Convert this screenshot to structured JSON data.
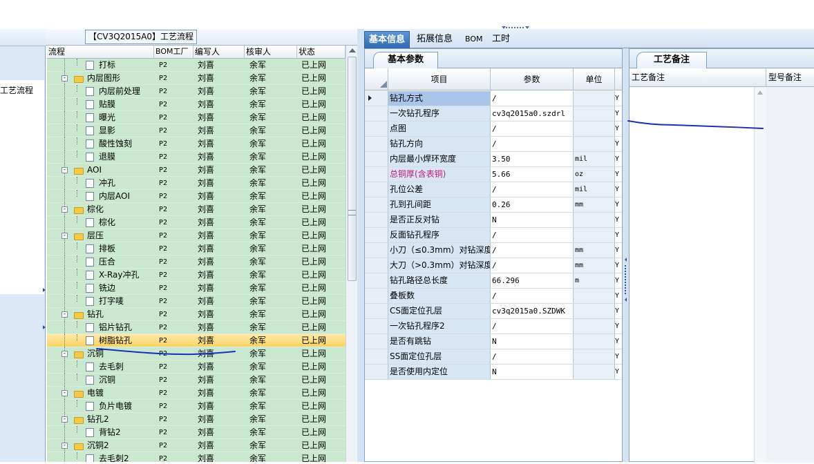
{
  "left_nav": {
    "item_label": "工艺流程"
  },
  "process": {
    "title": "【CV3Q2015A0】工艺流程",
    "columns": {
      "flow": "流程",
      "bom": "BOM工厂",
      "author": "编写人",
      "reviewer": "核审人",
      "status": "状态"
    },
    "rows": [
      {
        "name": "打标",
        "level": 1,
        "type": "doc",
        "bom": "P2",
        "author": "刘喜",
        "reviewer": "余军",
        "status": "已上网"
      },
      {
        "name": "内层图形",
        "level": 0,
        "type": "folder",
        "bom": "P2",
        "author": "刘喜",
        "reviewer": "余军",
        "status": "已上网"
      },
      {
        "name": "内层前处理",
        "level": 1,
        "type": "doc",
        "bom": "P2",
        "author": "刘喜",
        "reviewer": "余军",
        "status": "已上网"
      },
      {
        "name": "贴膜",
        "level": 1,
        "type": "doc",
        "bom": "P2",
        "author": "刘喜",
        "reviewer": "余军",
        "status": "已上网"
      },
      {
        "name": "曝光",
        "level": 1,
        "type": "doc",
        "bom": "P2",
        "author": "刘喜",
        "reviewer": "余军",
        "status": "已上网"
      },
      {
        "name": "显影",
        "level": 1,
        "type": "doc",
        "bom": "P2",
        "author": "刘喜",
        "reviewer": "余军",
        "status": "已上网"
      },
      {
        "name": "酸性蚀刻",
        "level": 1,
        "type": "doc",
        "bom": "P2",
        "author": "刘喜",
        "reviewer": "余军",
        "status": "已上网"
      },
      {
        "name": "退膜",
        "level": 1,
        "type": "doc",
        "bom": "P2",
        "author": "刘喜",
        "reviewer": "余军",
        "status": "已上网"
      },
      {
        "name": "AOI",
        "level": 0,
        "type": "folder",
        "bom": "P2",
        "author": "刘喜",
        "reviewer": "余军",
        "status": "已上网"
      },
      {
        "name": "冲孔",
        "level": 1,
        "type": "doc",
        "bom": "P2",
        "author": "刘喜",
        "reviewer": "余军",
        "status": "已上网"
      },
      {
        "name": "内层AOI",
        "level": 1,
        "type": "doc",
        "bom": "P2",
        "author": "刘喜",
        "reviewer": "余军",
        "status": "已上网"
      },
      {
        "name": "棕化",
        "level": 0,
        "type": "folder",
        "bom": "P2",
        "author": "刘喜",
        "reviewer": "余军",
        "status": "已上网"
      },
      {
        "name": "棕化",
        "level": 1,
        "type": "doc",
        "bom": "P2",
        "author": "刘喜",
        "reviewer": "余军",
        "status": "已上网"
      },
      {
        "name": "层压",
        "level": 0,
        "type": "folder",
        "bom": "P2",
        "author": "刘喜",
        "reviewer": "余军",
        "status": "已上网"
      },
      {
        "name": "排板",
        "level": 1,
        "type": "doc",
        "bom": "P2",
        "author": "刘喜",
        "reviewer": "余军",
        "status": "已上网"
      },
      {
        "name": "压合",
        "level": 1,
        "type": "doc",
        "bom": "P2",
        "author": "刘喜",
        "reviewer": "余军",
        "status": "已上网"
      },
      {
        "name": "X-Ray冲孔",
        "level": 1,
        "type": "doc",
        "bom": "P2",
        "author": "刘喜",
        "reviewer": "余军",
        "status": "已上网"
      },
      {
        "name": "铣边",
        "level": 1,
        "type": "doc",
        "bom": "P2",
        "author": "刘喜",
        "reviewer": "余军",
        "status": "已上网"
      },
      {
        "name": "打字唛",
        "level": 1,
        "type": "doc",
        "bom": "P2",
        "author": "刘喜",
        "reviewer": "余军",
        "status": "已上网"
      },
      {
        "name": "钻孔",
        "level": 0,
        "type": "folder",
        "bom": "P2",
        "author": "刘喜",
        "reviewer": "余军",
        "status": "已上网"
      },
      {
        "name": "铝片钻孔",
        "level": 1,
        "type": "doc",
        "bom": "P2",
        "author": "刘喜",
        "reviewer": "余军",
        "status": "已上网"
      },
      {
        "name": "树脂钻孔",
        "level": 1,
        "type": "doc",
        "bom": "P2",
        "author": "刘喜",
        "reviewer": "余军",
        "status": "已上网",
        "selected": true
      },
      {
        "name": "沉铜",
        "level": 0,
        "type": "folder",
        "bom": "P2",
        "author": "刘喜",
        "reviewer": "余军",
        "status": "已上网"
      },
      {
        "name": "去毛刺",
        "level": 1,
        "type": "doc",
        "bom": "P2",
        "author": "刘喜",
        "reviewer": "余军",
        "status": "已上网"
      },
      {
        "name": "沉铜",
        "level": 1,
        "type": "doc",
        "bom": "P2",
        "author": "刘喜",
        "reviewer": "余军",
        "status": "已上网"
      },
      {
        "name": "电镀",
        "level": 0,
        "type": "folder",
        "bom": "P2",
        "author": "刘喜",
        "reviewer": "余军",
        "status": "已上网"
      },
      {
        "name": "负片电镀",
        "level": 1,
        "type": "doc",
        "bom": "P2",
        "author": "刘喜",
        "reviewer": "余军",
        "status": "已上网"
      },
      {
        "name": "钻孔2",
        "level": 0,
        "type": "folder",
        "bom": "P2",
        "author": "刘喜",
        "reviewer": "余军",
        "status": "已上网"
      },
      {
        "name": "背钻2",
        "level": 1,
        "type": "doc",
        "bom": "P2",
        "author": "刘喜",
        "reviewer": "余军",
        "status": "已上网"
      },
      {
        "name": "沉铜2",
        "level": 0,
        "type": "folder",
        "bom": "P2",
        "author": "刘喜",
        "reviewer": "余军",
        "status": "已上网"
      },
      {
        "name": "去毛刺2",
        "level": 1,
        "type": "doc",
        "bom": "P2",
        "author": "刘喜",
        "reviewer": "余军",
        "status": "已上网"
      }
    ]
  },
  "tabs": {
    "items": [
      {
        "label": "基本信息",
        "active": true
      },
      {
        "label": "拓展信息",
        "active": false
      },
      {
        "label": "BOM",
        "active": false
      },
      {
        "label": "工时",
        "active": false
      }
    ]
  },
  "basic": {
    "tab_label": "基本参数",
    "columns": {
      "item": "项目",
      "param": "参数",
      "unit": "单位"
    },
    "rows": [
      {
        "item": "钻孔方式",
        "value": "/",
        "unit": "",
        "flag": "Y",
        "current": true
      },
      {
        "item": "一次钻孔程序",
        "value": "cv3q2015a0.szdrl",
        "unit": "",
        "flag": "Y"
      },
      {
        "item": "点图",
        "value": "/",
        "unit": "",
        "flag": "Y"
      },
      {
        "item": "钻孔方向",
        "value": "/",
        "unit": "",
        "flag": "Y"
      },
      {
        "item": "内层最小焊环宽度",
        "value": "3.50",
        "unit": "mil",
        "flag": "Y"
      },
      {
        "item": "总铜厚(含表铜)",
        "value": "5.66",
        "unit": "oz",
        "flag": "Y",
        "highlight": true
      },
      {
        "item": "孔位公差",
        "value": "/",
        "unit": "mil",
        "flag": "Y"
      },
      {
        "item": "孔到孔间距",
        "value": "0.26",
        "unit": "mm",
        "flag": "Y"
      },
      {
        "item": "是否正反对钻",
        "value": "N",
        "unit": "",
        "flag": "Y"
      },
      {
        "item": "反面钻孔程序",
        "value": "/",
        "unit": "",
        "flag": "Y"
      },
      {
        "item": "小刀（≤0.3mm）对钻深度",
        "value": "/",
        "unit": "mm",
        "flag": "Y"
      },
      {
        "item": "大刀（>0.3mm）对钻深度",
        "value": "/",
        "unit": "mm",
        "flag": "Y"
      },
      {
        "item": "钻孔路径总长度",
        "value": "66.296",
        "unit": "m",
        "flag": "Y"
      },
      {
        "item": "叠板数",
        "value": "/",
        "unit": "",
        "flag": "Y"
      },
      {
        "item": "CS面定位孔层",
        "value": "cv3q2015a0.SZDWK",
        "unit": "",
        "flag": "Y"
      },
      {
        "item": "一次钻孔程序2",
        "value": "/",
        "unit": "",
        "flag": "Y"
      },
      {
        "item": "是否有跳钻",
        "value": "N",
        "unit": "",
        "flag": "Y"
      },
      {
        "item": "SS面定位孔层",
        "value": "/",
        "unit": "",
        "flag": "Y"
      },
      {
        "item": "是否使用内定位",
        "value": "N",
        "unit": "",
        "flag": "Y"
      }
    ]
  },
  "notes": {
    "tab_label": "工艺备注",
    "columns": {
      "process_note": "工艺备注",
      "model_note": "型号备注"
    }
  },
  "colors": {
    "tree_background": "#c9e8cf",
    "selected_row": "#f8d466",
    "active_tab": "#2f69b3",
    "highlight_text": "#c0187a",
    "annotation_stroke": "#1a2fb8"
  },
  "icons": {
    "folder": "folder-icon",
    "doc": "document-icon",
    "expander": "expander-minus-icon",
    "row_pointer": "row-pointer-icon"
  }
}
